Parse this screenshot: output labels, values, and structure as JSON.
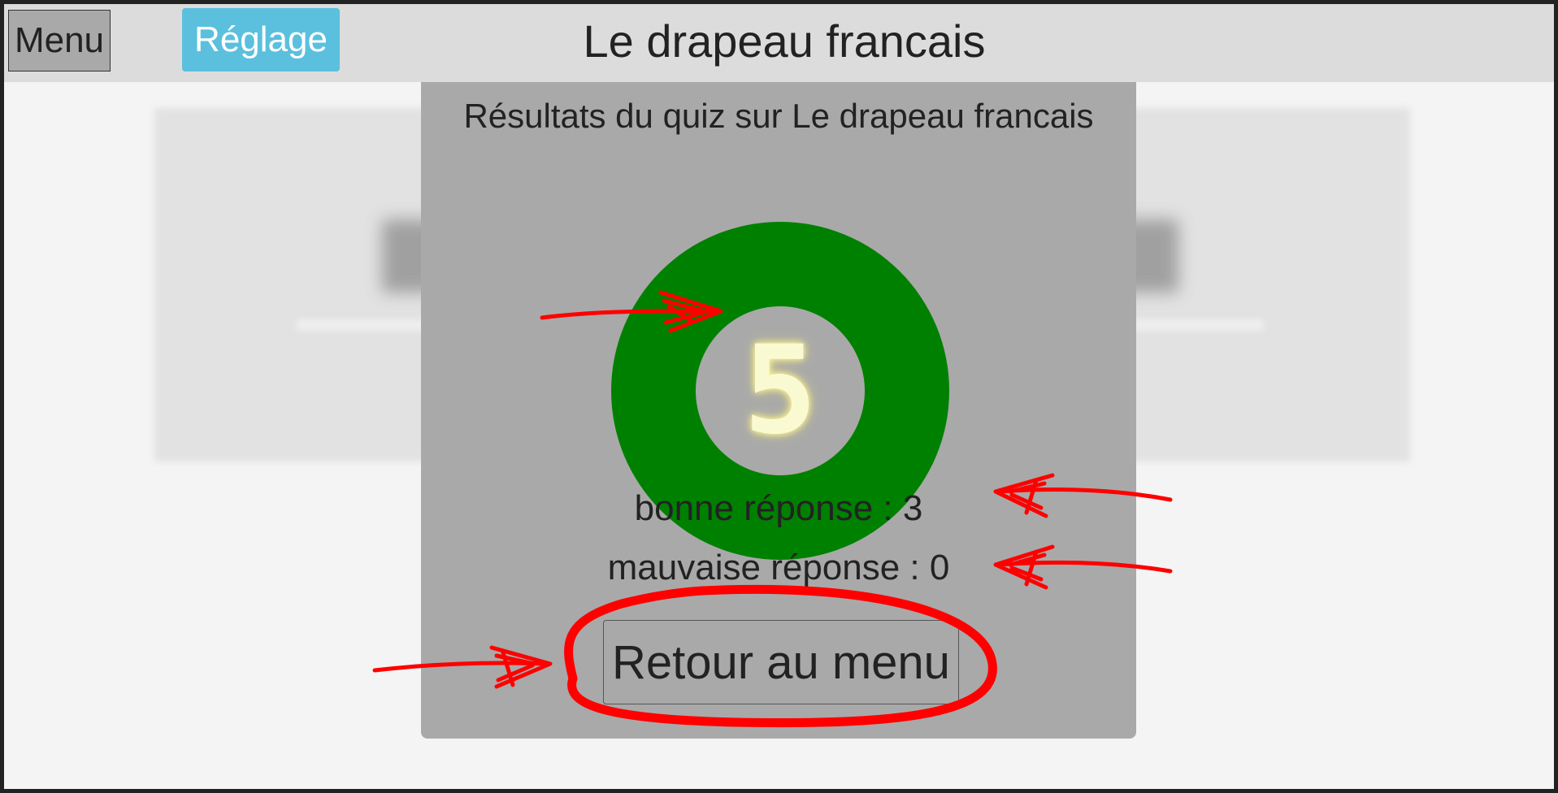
{
  "header": {
    "menu_label": "Menu",
    "settings_label": "Réglage",
    "title": "Le drapeau francais"
  },
  "results": {
    "title": "Résultats du quiz sur Le drapeau francais",
    "score": "5",
    "good_answers": "bonne réponse : 3",
    "bad_answers": "mauvaise réponse : 0",
    "back_label": "Retour au menu"
  },
  "colors": {
    "ring": "#008000",
    "modal": "#a9a9a9",
    "settings": "#5bc0de",
    "annotation": "#ff0000"
  },
  "annotations": {
    "type": "hand-drawn red arrows and circle",
    "targets": [
      "score",
      "good_answers",
      "bad_answers",
      "back_button"
    ]
  }
}
